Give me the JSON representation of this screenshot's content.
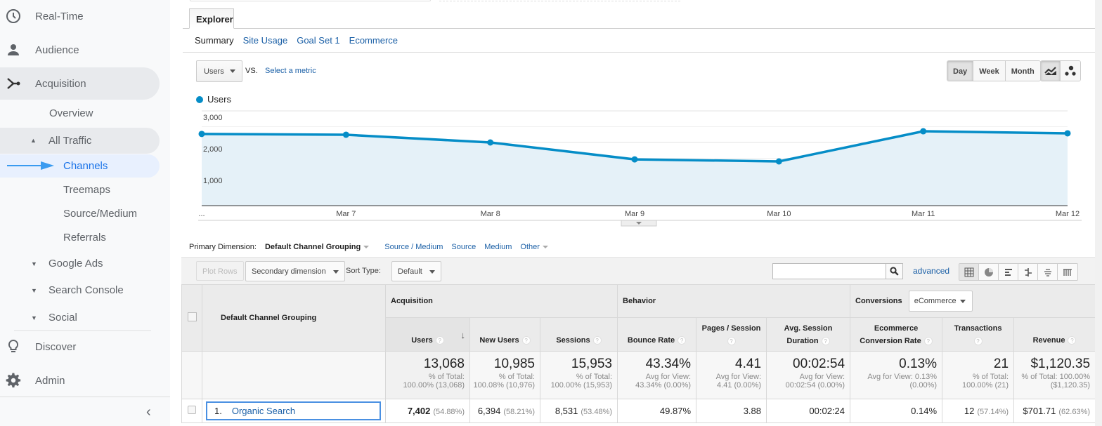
{
  "sidebar": {
    "items": [
      {
        "label": "Real-Time",
        "icon": "clock-icon"
      },
      {
        "label": "Audience",
        "icon": "person-icon"
      },
      {
        "label": "Acquisition",
        "icon": "acquisition-icon"
      }
    ],
    "acquisition_children": {
      "overview": "Overview",
      "all_traffic": "All Traffic",
      "all_traffic_children": [
        "Channels",
        "Treemaps",
        "Source/Medium",
        "Referrals"
      ],
      "google_ads": "Google Ads",
      "search_console": "Search Console",
      "social": "Social"
    },
    "bottom_items": [
      {
        "label": "Discover",
        "icon": "lightbulb-icon"
      },
      {
        "label": "Admin",
        "icon": "gear-icon"
      }
    ],
    "active_item": "Channels"
  },
  "explorer": {
    "tab_label": "Explorer",
    "subtabs": [
      "Summary",
      "Site Usage",
      "Goal Set 1",
      "Ecommerce"
    ],
    "active_subtab": "Summary",
    "metric_select": "Users",
    "vs_label": "VS.",
    "select_metric_link": "Select a metric",
    "granularity": [
      "Day",
      "Week",
      "Month"
    ],
    "active_granularity": "Day",
    "chart_types": [
      "line-chart-icon",
      "motion-chart-icon"
    ]
  },
  "chart_data": {
    "type": "area",
    "title": "",
    "legend": [
      "Users"
    ],
    "legend_position": "top-left",
    "series_color": "#058dc7",
    "x": [
      "...",
      "Mar 7",
      "Mar 8",
      "Mar 9",
      "Mar 10",
      "Mar 11",
      "Mar 12"
    ],
    "series": [
      {
        "name": "Users",
        "values": [
          2270,
          2245,
          2000,
          1465,
          1400,
          2355,
          2290
        ]
      }
    ],
    "y_ticks": [
      "1,000",
      "2,000",
      "3,000"
    ],
    "ylim": [
      0,
      3000
    ],
    "grid": true,
    "xlabel": "",
    "ylabel": ""
  },
  "dimensions": {
    "label": "Primary Dimension:",
    "active": "Default Channel Grouping",
    "links": [
      "Source / Medium",
      "Source",
      "Medium"
    ],
    "other": "Other"
  },
  "toolbar": {
    "plot_rows": "Plot Rows",
    "secondary_dimension": "Secondary dimension",
    "sort_type_label": "Sort Type:",
    "sort_type_value": "Default",
    "search_value": "",
    "advanced_link": "advanced",
    "views": [
      "table-view-icon",
      "pie-view-icon",
      "bar-view-icon",
      "comparison-view-icon",
      "term-cloud-icon",
      "pivot-view-icon"
    ]
  },
  "table": {
    "dimension_header": "Default Channel Grouping",
    "groups": {
      "acquisition": "Acquisition",
      "behavior": "Behavior",
      "conversions": "Conversions",
      "conversions_select": "eCommerce"
    },
    "columns": [
      {
        "line1": "Users",
        "line2": ""
      },
      {
        "line1": "New Users",
        "line2": ""
      },
      {
        "line1": "Sessions",
        "line2": ""
      },
      {
        "line1": "Bounce Rate",
        "line2": ""
      },
      {
        "line1": "Pages / Session",
        "line2": ""
      },
      {
        "line1": "Avg. Session",
        "line2": "Duration"
      },
      {
        "line1": "Ecommerce",
        "line2": "Conversion Rate"
      },
      {
        "line1": "Transactions",
        "line2": ""
      },
      {
        "line1": "Revenue",
        "line2": ""
      }
    ],
    "totals": [
      {
        "value": "13,068",
        "sub1": "% of Total:",
        "sub2": "100.00% (13,068)"
      },
      {
        "value": "10,985",
        "sub1": "% of Total:",
        "sub2": "100.08% (10,976)"
      },
      {
        "value": "15,953",
        "sub1": "% of Total:",
        "sub2": "100.00% (15,953)"
      },
      {
        "value": "43.34%",
        "sub1": "Avg for View:",
        "sub2": "43.34% (0.00%)"
      },
      {
        "value": "4.41",
        "sub1": "Avg for View:",
        "sub2": "4.41 (0.00%)"
      },
      {
        "value": "00:02:54",
        "sub1": "Avg for View:",
        "sub2": "00:02:54 (0.00%)"
      },
      {
        "value": "0.13%",
        "sub1": "Avg for View: 0.13%",
        "sub2": "(0.00%)"
      },
      {
        "value": "21",
        "sub1": "% of Total:",
        "sub2": "100.00% (21)"
      },
      {
        "value": "$1,120.35",
        "sub1": "% of Total: 100.00%",
        "sub2": "($1,120.35)"
      }
    ],
    "rows": [
      {
        "index": "1.",
        "name": "Organic Search",
        "cells": [
          {
            "value": "7,402",
            "pct": "(54.88%)"
          },
          {
            "value": "6,394",
            "pct": "(58.21%)"
          },
          {
            "value": "8,531",
            "pct": "(53.48%)"
          },
          {
            "value": "49.87%",
            "pct": ""
          },
          {
            "value": "3.88",
            "pct": ""
          },
          {
            "value": "00:02:24",
            "pct": ""
          },
          {
            "value": "0.14%",
            "pct": ""
          },
          {
            "value": "12",
            "pct": "(57.14%)"
          },
          {
            "value": "$701.71",
            "pct": "(62.63%)"
          }
        ]
      }
    ]
  }
}
